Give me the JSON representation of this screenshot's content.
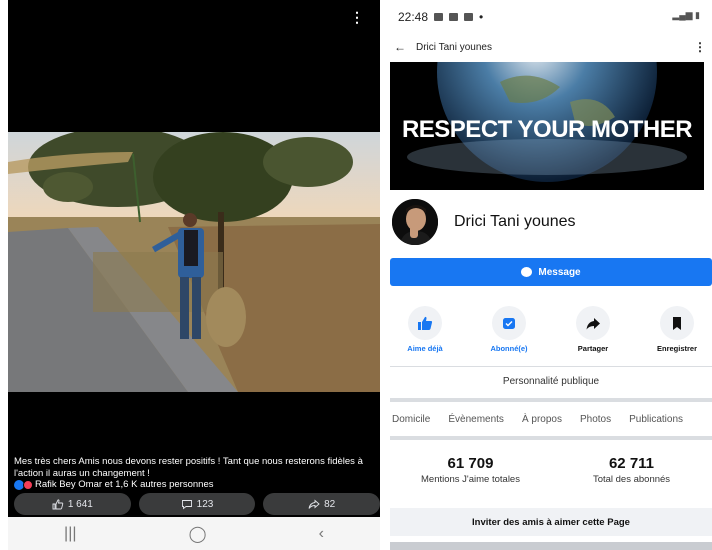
{
  "left": {
    "caption": "Mes très chers Amis nous devons rester positifs ! Tant que nous resterons fidèles à l'action il auras un changement !",
    "reactions_text": "Rafik Bey Omar et 1,6 K autres personnes",
    "likes_count": "1 641",
    "comments_count": "123",
    "shares_count": "82",
    "icons": [
      "more-vert-icon",
      "like-icon",
      "comment-icon",
      "share-icon",
      "recents-icon",
      "home-icon",
      "back-icon"
    ]
  },
  "right": {
    "status_time": "22:48",
    "header_name": "Drici Tani younes",
    "cover_text": "RESPECT YOUR MOTHER",
    "page_name": "Drici Tani younes",
    "message_label": "Message",
    "quick_actions": [
      {
        "label": "Aime déjà",
        "icon": "thumbs-up-icon"
      },
      {
        "label": "Abonné(e)",
        "icon": "following-icon"
      },
      {
        "label": "Partager",
        "icon": "share-arrow-icon"
      },
      {
        "label": "Enregistrer",
        "icon": "bookmark-icon"
      }
    ],
    "category": "Personnalité publique",
    "tabs": [
      "Domicile",
      "Évènements",
      "À propos",
      "Photos",
      "Publications"
    ],
    "stats": [
      {
        "value": "61 709",
        "label": "Mentions J'aime totales"
      },
      {
        "value": "62 711",
        "label": "Total des abonnés"
      }
    ],
    "invite_label": "Inviter des amis à aimer cette Page"
  },
  "colors": {
    "accent": "#1877f2",
    "dark": "#000000",
    "chip": "#3a3b3c"
  }
}
